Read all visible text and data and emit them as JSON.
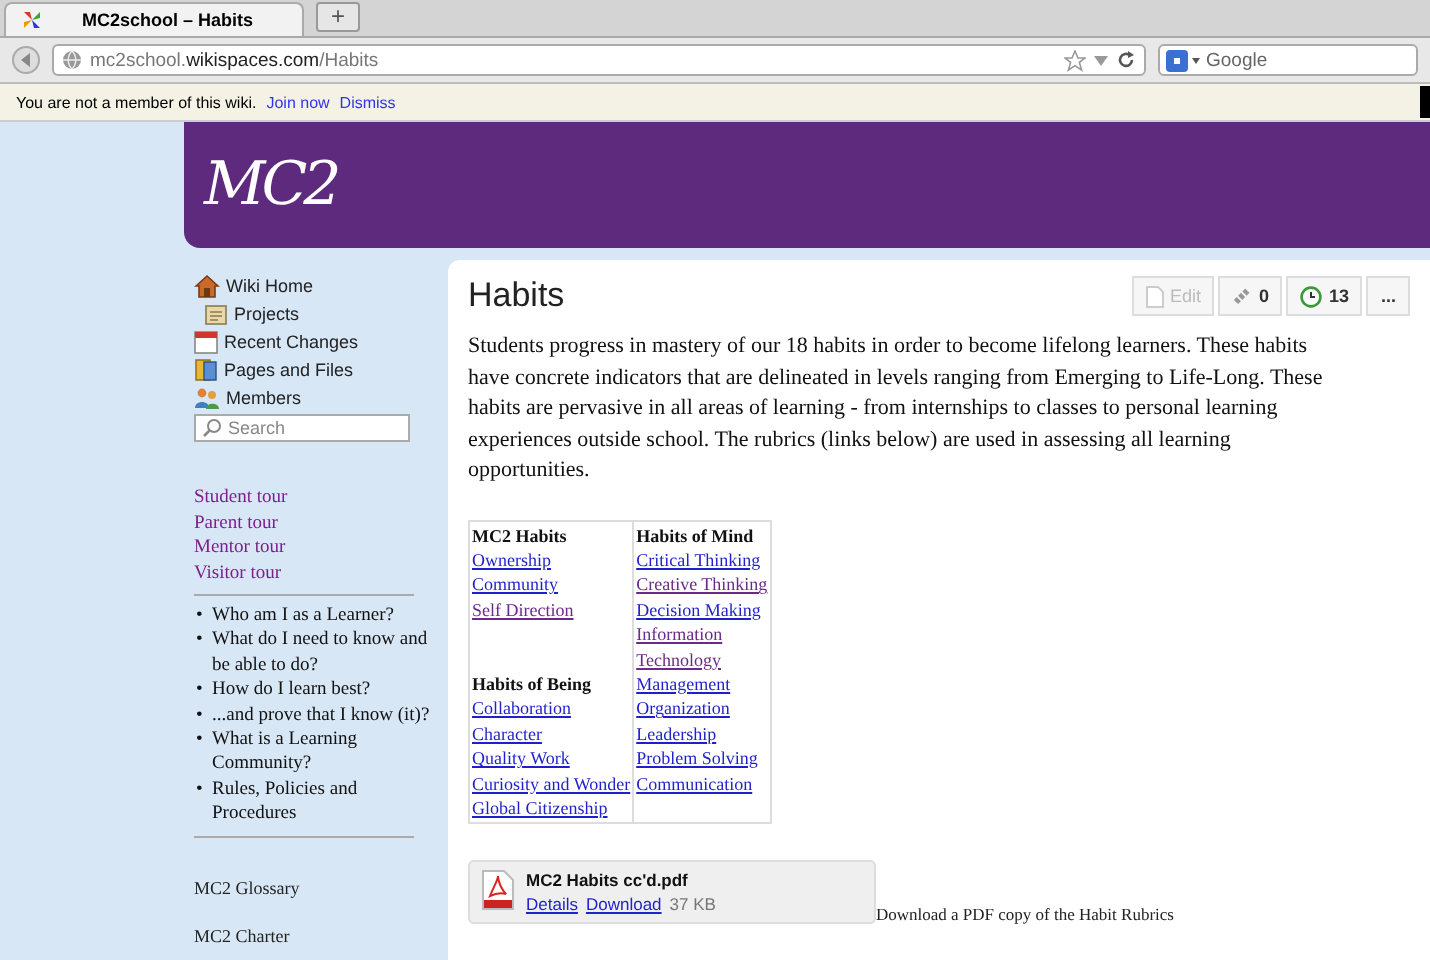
{
  "browser": {
    "tab_title": "MC2school – Habits",
    "new_tab": "+",
    "url_host_prefix": "mc2school.",
    "url_host_domain": "wikispaces.com",
    "url_path": "/Habits",
    "search_placeholder": "Google"
  },
  "notice": {
    "text": "You are not a member of this wiki.",
    "links": [
      "Join now",
      "Dismiss"
    ]
  },
  "banner": {
    "logo": "MC2"
  },
  "sidebar": {
    "nav": [
      "Wiki Home",
      "Projects",
      "Recent Changes",
      "Pages and Files",
      "Members"
    ],
    "search_placeholder": "Search",
    "tours": [
      "Student tour",
      "Parent tour",
      "Mentor tour",
      "Visitor tour"
    ],
    "questions": [
      {
        "bullet": "•",
        "text": "Who am I as a Learner?"
      },
      {
        "bullet": "•",
        "text": "What do I need to know and be able to do?"
      },
      {
        "bullet": "•",
        "text": "How do I learn best?"
      },
      {
        "bullet": "•",
        "text": "...and prove that I know (it)?"
      },
      {
        "bullet": "•",
        "text": "What is a Learning Community?"
      },
      {
        "bullet": "•",
        "text": "Rules, Policies and Procedures"
      }
    ],
    "footer_links": [
      "MC2 Glossary",
      "MC2 Charter"
    ]
  },
  "page": {
    "title": "Habits",
    "toolbar": {
      "edit": "Edit",
      "links_count": "0",
      "history_count": "13",
      "more": "..."
    },
    "intro": "Students progress in mastery of our 18 habits in order to become lifelong learners. These habits have concrete indicators that are delineated in levels ranging from Emerging to Life-Long. These habits are pervasive in all areas of learning - from internships to classes to personal learning experiences outside school. The rubrics (links below) are used in assessing all learning opportunities.",
    "table": {
      "columns": [
        [
          {
            "kind": "heading",
            "text": "MC2 Habits"
          },
          {
            "kind": "link",
            "text": "Ownership",
            "visited": false
          },
          {
            "kind": "link",
            "text": "Community",
            "visited": false
          },
          {
            "kind": "link",
            "text": "Self Direction",
            "visited": true
          },
          {
            "kind": "gap"
          },
          {
            "kind": "gap"
          },
          {
            "kind": "heading",
            "text": "Habits of Being"
          },
          {
            "kind": "link",
            "text": "Collaboration",
            "visited": false
          },
          {
            "kind": "link",
            "text": "Character",
            "visited": false
          },
          {
            "kind": "link",
            "text": "Quality Work",
            "visited": false
          },
          {
            "kind": "link",
            "text": "Curiosity and Wonder",
            "visited": false
          },
          {
            "kind": "link",
            "text": "Global Citizenship",
            "visited": false
          }
        ],
        [
          {
            "kind": "heading",
            "text": "Habits of Mind"
          },
          {
            "kind": "link",
            "text": "Critical Thinking",
            "visited": false
          },
          {
            "kind": "link",
            "text": "Creative Thinking",
            "visited": true
          },
          {
            "kind": "link",
            "text": "Decision Making",
            "visited": false
          },
          {
            "kind": "link",
            "text": "Information",
            "visited": true
          },
          {
            "kind": "link",
            "text": "Technology",
            "visited": true
          },
          {
            "kind": "link",
            "text": "Management",
            "visited": false
          },
          {
            "kind": "link",
            "text": "Organization",
            "visited": false
          },
          {
            "kind": "link",
            "text": "Leadership",
            "visited": false
          },
          {
            "kind": "link",
            "text": "Problem Solving",
            "visited": false
          },
          {
            "kind": "link",
            "text": "Communication",
            "visited": false
          }
        ]
      ]
    },
    "file": {
      "name": "MC2 Habits cc'd.pdf",
      "details": "Details",
      "download": "Download",
      "size": "37 KB",
      "caption": "Download a PDF copy of the Habit Rubrics"
    }
  }
}
